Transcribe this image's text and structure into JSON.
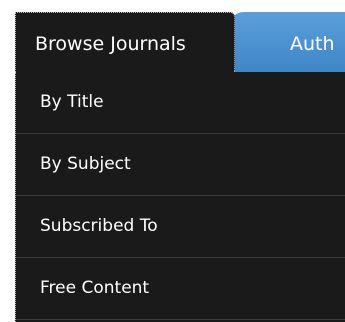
{
  "tabs": {
    "active": {
      "label": "Browse Journals"
    },
    "next": {
      "label": "Auth"
    }
  },
  "menu": {
    "items": [
      {
        "label": "By Title"
      },
      {
        "label": "By Subject"
      },
      {
        "label": "Subscribed To"
      },
      {
        "label": "Free Content"
      }
    ]
  },
  "colors": {
    "panel_bg": "#1a1a1a",
    "tab_blue": "#4a8fce",
    "divider": "#3a3a3a",
    "text": "#ffffff"
  }
}
